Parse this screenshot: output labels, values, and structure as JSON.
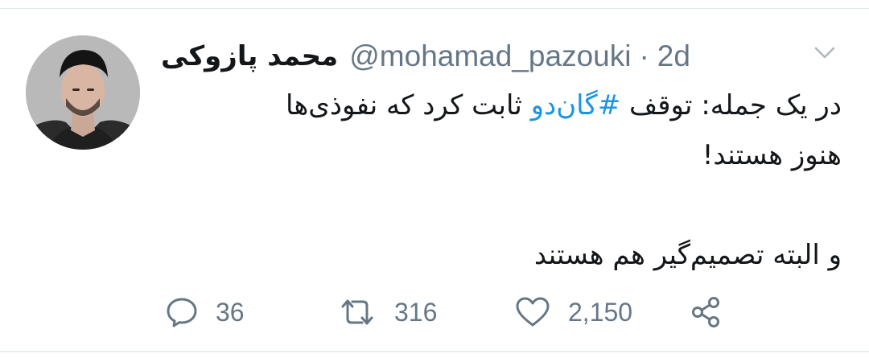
{
  "tweet": {
    "author": {
      "display_name": "محمد پازوکی",
      "handle": "@mohamad_pazouki",
      "avatar_icon": "profile-photo"
    },
    "separator": "·",
    "timestamp": "2d",
    "text": {
      "line1_before": "در یک جمله: توقف",
      "hashtag": "#گان‌دو",
      "line1_after": "ثابت کرد که نفوذی‌ها",
      "line2": "هنوز هستند!",
      "line4": "و البته تصمیم‌گیر هم هستند"
    },
    "stats": {
      "replies": "36",
      "retweets": "316",
      "likes": "2,150"
    },
    "icons": {
      "menu": "chevron-down-icon",
      "reply": "reply-icon",
      "retweet": "retweet-icon",
      "like": "heart-icon",
      "share": "share-icon"
    },
    "colors": {
      "hashtag": "#1b95e0",
      "secondary_text": "#657786",
      "primary_text": "#14171a"
    }
  }
}
